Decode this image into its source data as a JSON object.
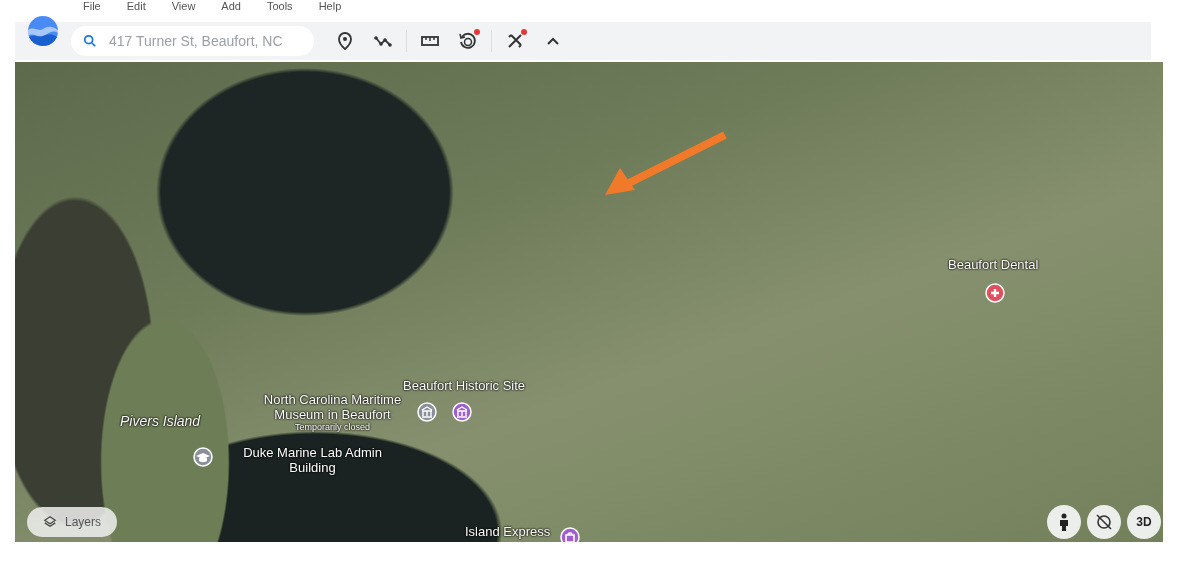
{
  "menu": [
    "File",
    "Edit",
    "View",
    "Add",
    "Tools",
    "Help"
  ],
  "search": {
    "value": "417 Turner St, Beaufort, NC"
  },
  "toolbar": [
    {
      "kind": "pin",
      "badge": false
    },
    {
      "kind": "path",
      "badge": false
    },
    {
      "kind": "ruler",
      "badge": false
    },
    {
      "kind": "history",
      "badge": true
    },
    {
      "kind": "tools",
      "badge": true
    },
    {
      "kind": "collapse",
      "badge": false
    }
  ],
  "map": {
    "places": [
      {
        "kind": "text",
        "name": "Beaufort Dental",
        "color": "#e0505e"
      },
      {
        "kind": "text",
        "name": "Beaufort Historic Site",
        "color": "#a05fd0"
      },
      {
        "kind": "text",
        "name": "North Carolina Maritime Museum in Beaufort",
        "note": "Temporarily closed",
        "color": "#8a9099"
      },
      {
        "kind": "italic",
        "name": "Pivers Island"
      },
      {
        "kind": "text",
        "name": "Duke Marine Lab Admin Building",
        "color": "#8a9099"
      },
      {
        "kind": "text",
        "name": "Island Express",
        "color": "#a05fd0"
      }
    ],
    "layers_button": "Layers",
    "controls": [
      {
        "kind": "person"
      },
      {
        "kind": "compass"
      },
      {
        "kind": "label",
        "text": "3D"
      }
    ]
  }
}
